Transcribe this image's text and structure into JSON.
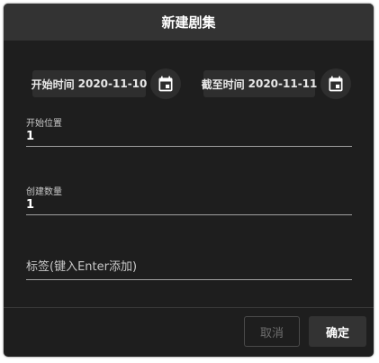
{
  "dialog": {
    "title": "新建剧集"
  },
  "dates": {
    "start_label": "开始时间",
    "start_value": "2020-11-10",
    "end_label": "截至时间",
    "end_value": "2020-11-11"
  },
  "fields": {
    "start_position_label": "开始位置",
    "start_position_value": "1",
    "create_count_label": "创建数量",
    "create_count_value": "1"
  },
  "tags": {
    "placeholder": "标签(键入Enter添加)"
  },
  "footer": {
    "cancel_label": "取消",
    "confirm_label": "确定"
  },
  "icons": {
    "start_date_picker": "calendar-icon",
    "end_date_picker": "calendar-icon"
  },
  "colors": {
    "dialog_bg": "#1e1e1e",
    "header_bg": "#333333",
    "text": "#ffffff",
    "cancel_disabled": "#6e6e6e"
  }
}
